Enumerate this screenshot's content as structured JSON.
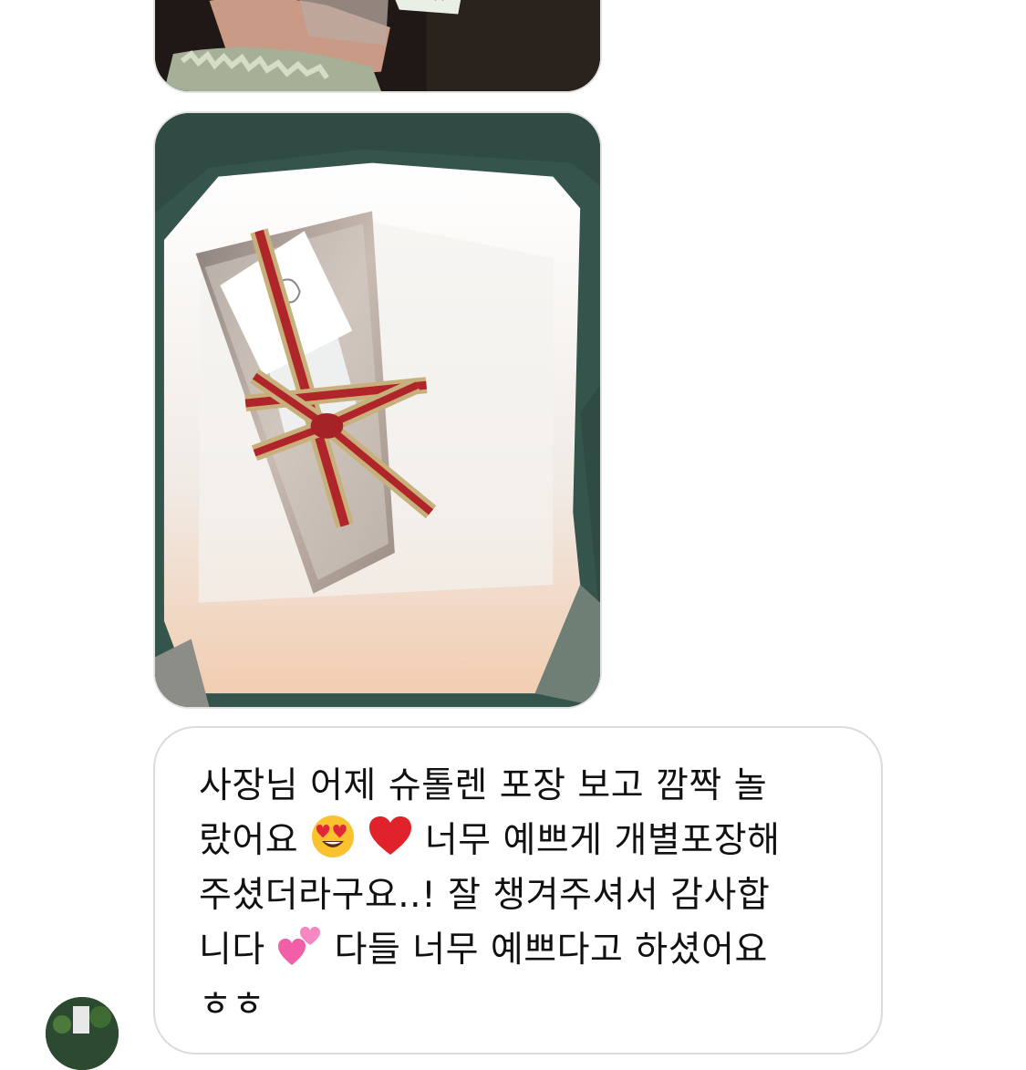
{
  "thread": {
    "photo_1_alt": "",
    "photo_2_alt": ""
  },
  "message": {
    "line1": "사장님 어제 슈톨렌 포장 보고 깜짝 놀",
    "line2_a": "랐어요",
    "line2_b": "너무 예쁘게 개별포장해",
    "line3": "주셨더라구요..! 잘 챙겨주셔서 감사합",
    "line4_a": "니다",
    "line4_b": "다들 너무 예쁘다고 하셨어요",
    "line5": "ㅎㅎ",
    "emojis": [
      "heart-eyes-emoji",
      "red-heart-emoji",
      "two-hearts-emoji"
    ]
  },
  "colors": {
    "bubble_border": "#dbdbdb",
    "text": "#111111",
    "background": "#ffffff"
  }
}
